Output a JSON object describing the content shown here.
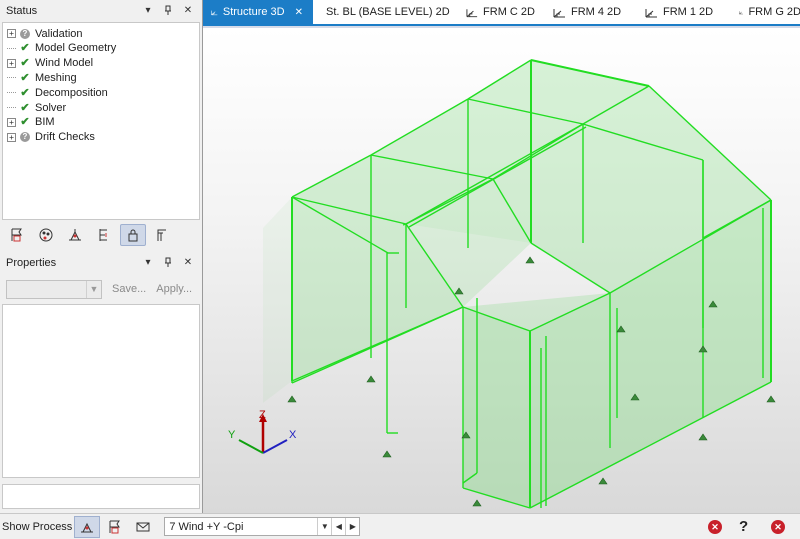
{
  "status_pane": {
    "title": "Status",
    "items": [
      {
        "label": "Validation",
        "expandable": true,
        "state": "pending"
      },
      {
        "label": "Model Geometry",
        "expandable": false,
        "state": "ok"
      },
      {
        "label": "Wind Model",
        "expandable": true,
        "state": "ok"
      },
      {
        "label": "Meshing",
        "expandable": false,
        "state": "ok"
      },
      {
        "label": "Decomposition",
        "expandable": false,
        "state": "ok"
      },
      {
        "label": "Solver",
        "expandable": false,
        "state": "ok"
      },
      {
        "label": "BIM",
        "expandable": true,
        "state": "ok"
      },
      {
        "label": "Drift Checks",
        "expandable": true,
        "state": "pending"
      }
    ]
  },
  "properties_pane": {
    "title": "Properties",
    "save_label": "Save...",
    "apply_label": "Apply..."
  },
  "tabs": [
    {
      "label": "Structure 3D",
      "active": true,
      "icon": "structure-3d-icon"
    },
    {
      "label": "St. BL (BASE LEVEL) 2D",
      "active": false,
      "icon": "plan-2d-icon"
    },
    {
      "label": "FRM C 2D",
      "active": false,
      "icon": "frame-2d-icon"
    },
    {
      "label": "FRM 4 2D",
      "active": false,
      "icon": "frame-2d-icon"
    },
    {
      "label": "FRM 1 2D",
      "active": false,
      "icon": "frame-2d-icon"
    },
    {
      "label": "FRM G 2D",
      "active": false,
      "icon": "frame-2d-icon"
    }
  ],
  "axes": {
    "x": "X",
    "y": "Y",
    "z": "Z"
  },
  "bottom_bar": {
    "show_process_label": "Show Process",
    "load_case_value": "7 Wind +Y -Cpi"
  },
  "colors": {
    "accent": "#1c7dc7",
    "model_edge": "#22dd22",
    "model_fill": "#8fdc8f",
    "error": "#c8202a"
  }
}
